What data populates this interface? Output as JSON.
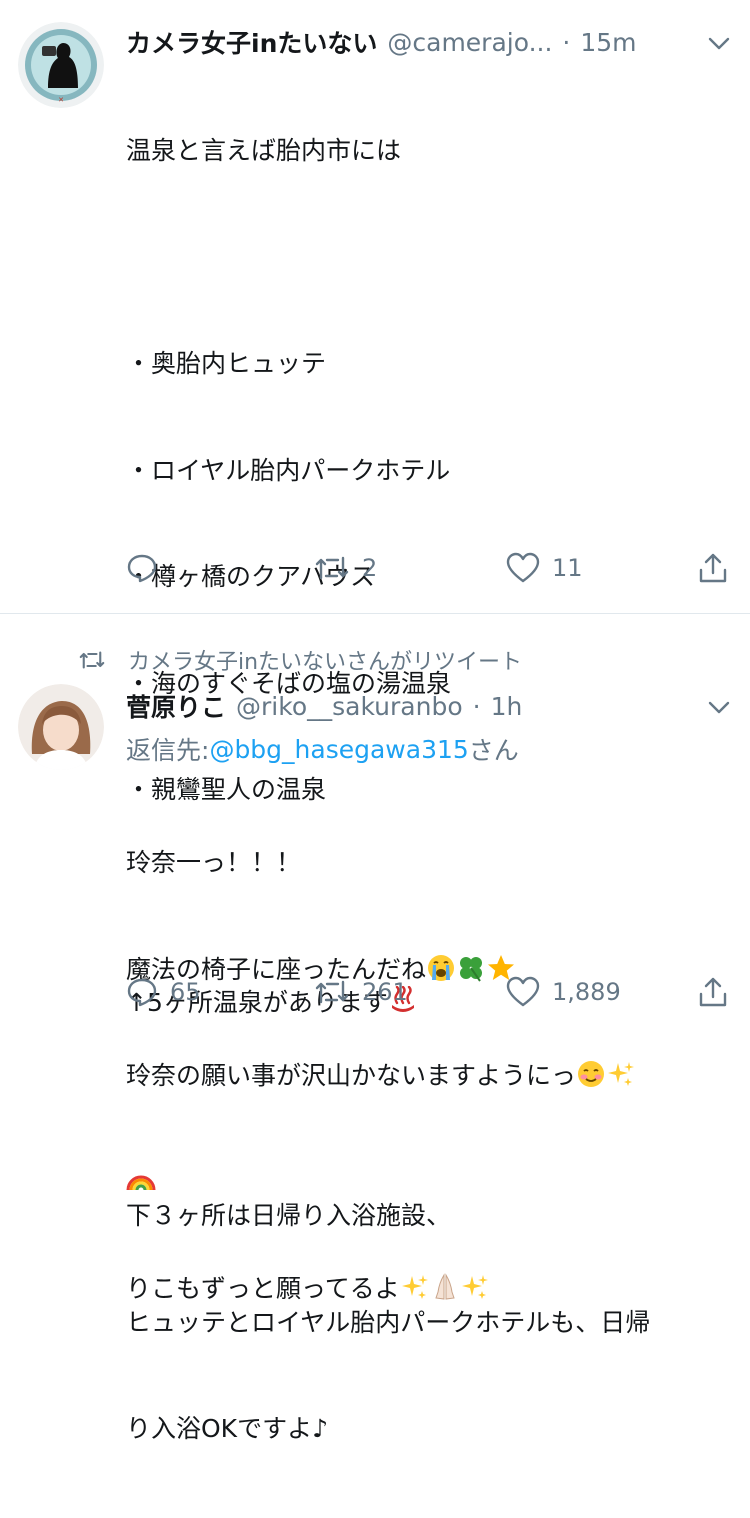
{
  "tweet1": {
    "display_name": "カメラ女子inたいない",
    "handle": "@camerajo...",
    "separator": "·",
    "time": "15m",
    "lines": [
      "温泉と言えば胎内市には",
      "",
      "・奥胎内ヒュッテ",
      "・ロイヤル胎内パークホテル",
      "・樽ヶ橋のクアハウス",
      "・海のすぐそばの塩の湯温泉",
      "・親鸞聖人の温泉",
      "",
      "↑5ヶ所温泉があります",
      "",
      "下３ヶ所は日帰り入浴施設、",
      "ヒュッテとロイヤル胎内パークホテルも、日帰",
      "り入浴OKですよ♪"
    ],
    "reply_count": "",
    "retweet_count": "2",
    "like_count": "11"
  },
  "retweet_indicator": "カメラ女子inたいないさんがリツイート",
  "tweet2": {
    "display_name": "菅原りこ",
    "handle": "@riko__sakuranbo",
    "separator": "·",
    "time": "1h",
    "reply_prefix": "返信先: ",
    "reply_handle": "@bbg_hasegawa315",
    "reply_suffix": "さん",
    "lines": [
      "玲奈一っ！！！",
      "魔法の椅子に座ったんだね",
      "玲奈の願い事が沢山かないますようにっ",
      "",
      "りこもずっと願ってるよ"
    ],
    "reply_count": "65",
    "retweet_count": "261",
    "like_count": "1,889"
  },
  "icons": [
    "hot-springs-emoji",
    "reply-icon",
    "retweet-icon",
    "like-icon",
    "share-icon",
    "chevron-down-icon",
    "crying-face-emoji",
    "clover-emoji",
    "star-emoji",
    "smiling-face-emoji",
    "sparkles-emoji",
    "rainbow-emoji",
    "folded-hands-emoji"
  ],
  "colors": {
    "secondary_text": "#657786",
    "link": "#1da1f2",
    "divider": "#e1e8ed"
  }
}
